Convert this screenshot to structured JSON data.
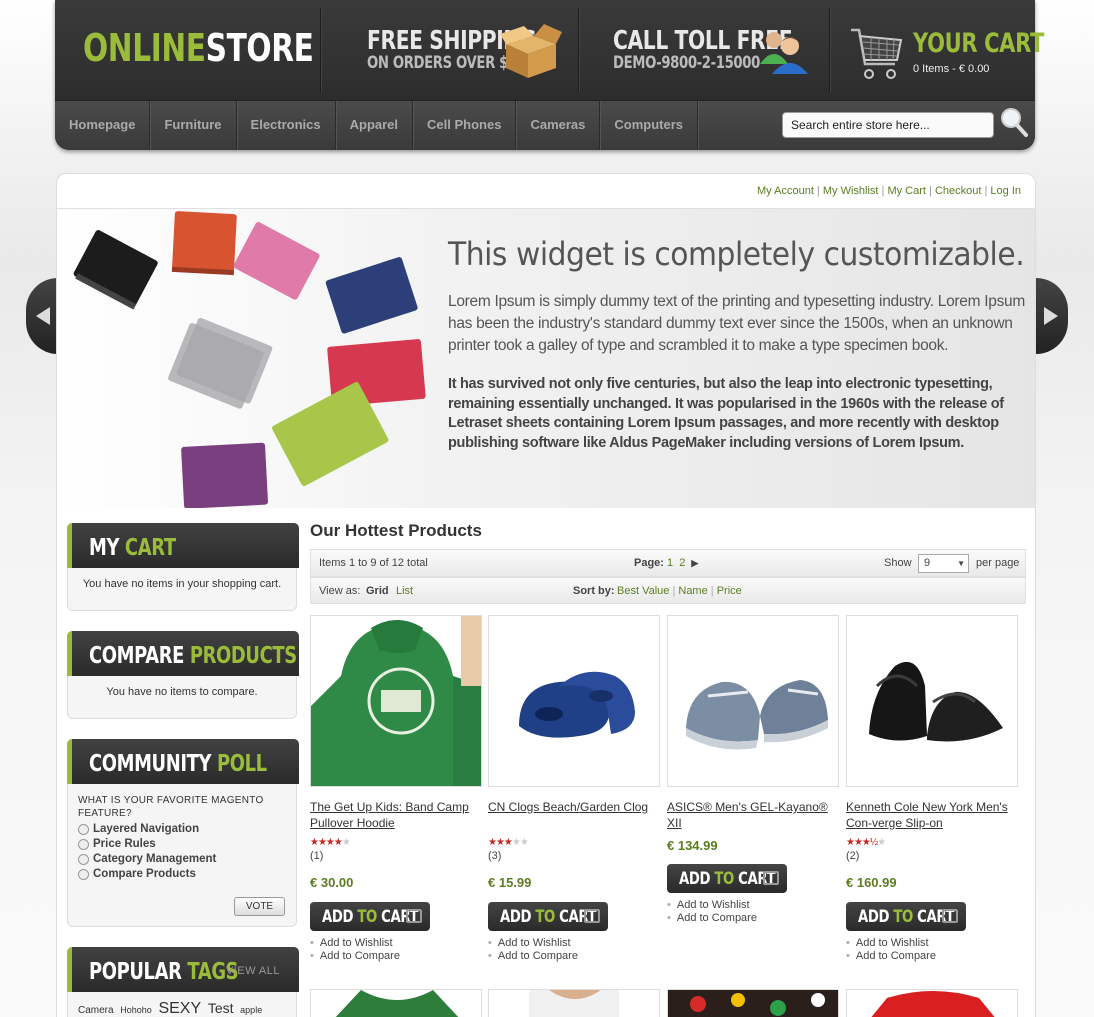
{
  "header": {
    "logo": {
      "part1": "ONLINE",
      "part2": "STORE"
    },
    "shipping": {
      "title": "FREE SHIPPING",
      "subtitle": "ON ORDERS OVER $60"
    },
    "call": {
      "title": "CALL TOLL FREE",
      "phone": "DEMO-9800-2-15000"
    },
    "cart": {
      "title_part1": "YOUR",
      "title_part2": "CART",
      "summary": "0 Items - € 0.00"
    }
  },
  "nav": {
    "items": [
      "Homepage",
      "Furniture",
      "Electronics",
      "Apparel",
      "Cell Phones",
      "Cameras",
      "Computers"
    ],
    "search_placeholder": "Search entire store here..."
  },
  "toplinks": [
    "My Account",
    "My Wishlist",
    "My Cart",
    "Checkout",
    "Log In"
  ],
  "banner": {
    "title": "This widget is completely customizable.",
    "p1": "Lorem  Ipsum is simply dummy text of the printing and typesetting industry. Lorem Ipsum has been the industry's standard dummy text ever since the 1500s, when an unknown printer took a galley of type and scrambled it to make a type specimen book.",
    "p2": "It has survived not only five centuries, but also the leap into electronic typesetting, remaining essentially unchanged. It was popularised in the 1960s with the release of Letraset sheets containing Lorem Ipsum passages, and more recently with desktop publishing software like Aldus PageMaker including versions of Lorem Ipsum."
  },
  "sidebar": {
    "mycart": {
      "t1": "MY",
      "t2": "CART",
      "text": "You have no items in your shopping cart."
    },
    "compare": {
      "t1": "COMPARE",
      "t2": "PRODUCTS",
      "text": "You have no items to compare."
    },
    "poll": {
      "t1": "COMMUNITY",
      "t2": "POLL",
      "question": "WHAT IS YOUR FAVORITE MAGENTO FEATURE?",
      "options": [
        "Layered Navigation",
        "Price Rules",
        "Category Management",
        "Compare Products"
      ],
      "vote": "VOTE"
    },
    "tags": {
      "t1": "POPULAR",
      "t2": "TAGS",
      "viewall": "VIEW ALL",
      "items": [
        "Camera",
        "Hohoho",
        "SEXY",
        "Test",
        "apple"
      ]
    }
  },
  "products_section": {
    "title": "Our Hottest Products",
    "items_count": "Items 1 to 9 of 12 total",
    "page_label": "Page:",
    "pages": [
      "1",
      "2"
    ],
    "show_label": "Show",
    "show_value": "9",
    "per_page": "per page",
    "view_as": "View as:",
    "view_grid": "Grid",
    "view_list": "List",
    "sort_by": "Sort by:",
    "sort_options": [
      "Best Value",
      "Name",
      "Price"
    ]
  },
  "products": [
    {
      "name": "The Get Up Kids: Band Camp Pullover Hoodie",
      "rating": 4,
      "reviews": "(1)",
      "price": "€ 30.00"
    },
    {
      "name": "CN Clogs Beach/Garden Clog",
      "rating": 3,
      "reviews": "(3)",
      "price": "€ 15.99"
    },
    {
      "name": "ASICS® Men's GEL-Kayano® XII",
      "rating": null,
      "reviews": "",
      "price": "€ 134.99"
    },
    {
      "name": "Kenneth Cole New York Men's Con-verge Slip-on",
      "rating": 3.5,
      "reviews": "(2)",
      "price": "€ 160.99"
    }
  ],
  "product_actions": {
    "add_part1": "ADD",
    "add_part2": "TO",
    "add_part3": "CART",
    "wishlist": "Add to Wishlist",
    "compare": "Add to Compare"
  },
  "colors": {
    "accent": "#9bbb3a",
    "link": "#5b7d22",
    "dark": "#2f2f2f"
  }
}
